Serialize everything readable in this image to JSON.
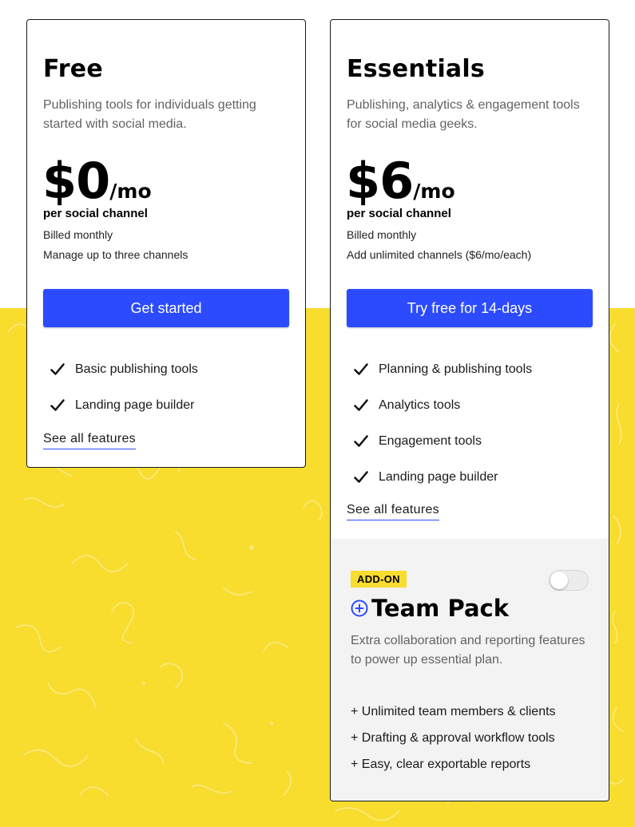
{
  "colors": {
    "accent_blue": "#2c4bff",
    "background_yellow": "#f8dc2e",
    "addon_bg": "#f3f3f3"
  },
  "plans": [
    {
      "title": "Free",
      "description": "Publishing tools for individuals getting started with social media.",
      "price_amount": "$0",
      "price_period": "/mo",
      "per_unit": "per social channel",
      "billing": "Billed monthly",
      "channels_note": "Manage up to three channels",
      "cta_label": "Get started",
      "features": [
        "Basic publishing tools",
        "Landing page builder"
      ],
      "see_all_label": "See all features"
    },
    {
      "title": "Essentials",
      "description": "Publishing, analytics & engagement tools for social media geeks.",
      "price_amount": "$6",
      "price_period": "/mo",
      "per_unit": "per social channel",
      "billing": "Billed monthly",
      "channels_note": "Add unlimited channels ($6/mo/each)",
      "cta_label": "Try free for 14-days",
      "features": [
        "Planning & publishing tools",
        "Analytics tools",
        "Engagement tools",
        "Landing page builder"
      ],
      "see_all_label": "See all features"
    }
  ],
  "addon": {
    "badge": "ADD-ON",
    "title": "Team Pack",
    "toggle_on": false,
    "description": "Extra collaboration and reporting features to power up essential plan.",
    "items": [
      "+ Unlimited team members & clients",
      "+ Drafting & approval workflow tools",
      "+ Easy, clear exportable reports"
    ]
  },
  "icons": {
    "check": "check-icon",
    "plus_circle": "plus-circle-icon"
  }
}
